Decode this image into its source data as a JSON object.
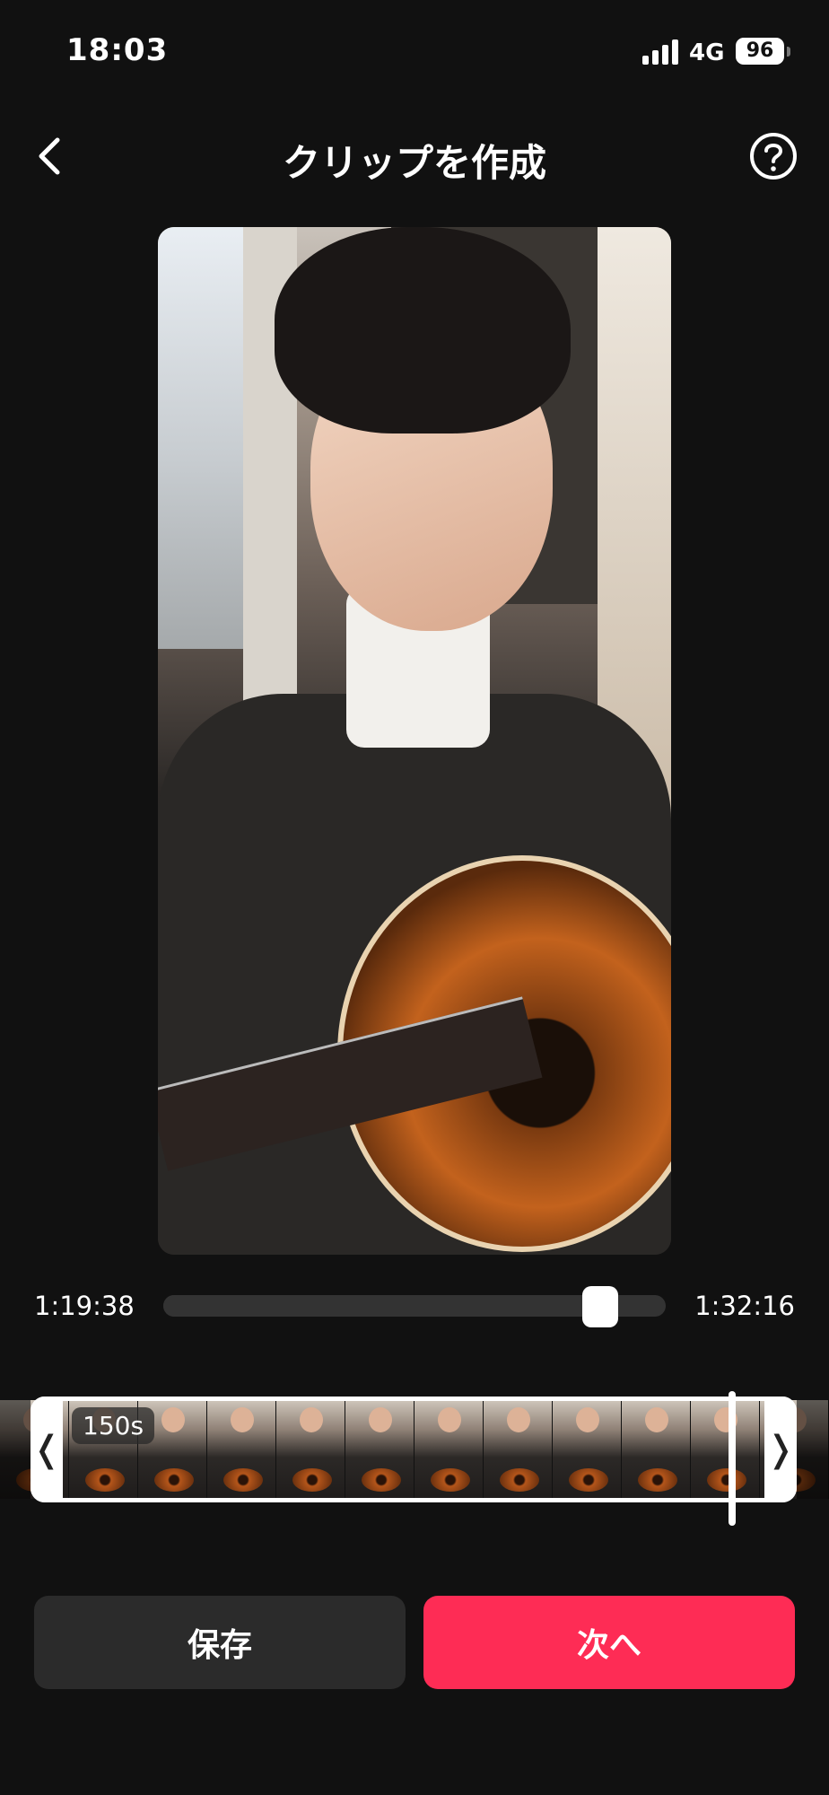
{
  "status_bar": {
    "time": "18:03",
    "network": "4G",
    "battery": "96"
  },
  "nav": {
    "title": "クリップを作成",
    "back_icon": "chevron-left-icon",
    "help_icon": "question-circle-icon"
  },
  "player": {
    "time_start": "1:19:38",
    "time_end": "1:32:16",
    "progress": 0.87
  },
  "timeline": {
    "duration_badge": "150s",
    "left_handle": "❬",
    "right_handle": "❭"
  },
  "actions": {
    "save_label": "保存",
    "next_label": "次へ"
  },
  "colors": {
    "accent": "#fe2c55",
    "background": "#111111",
    "secondary_button": "#2b2b2b"
  }
}
